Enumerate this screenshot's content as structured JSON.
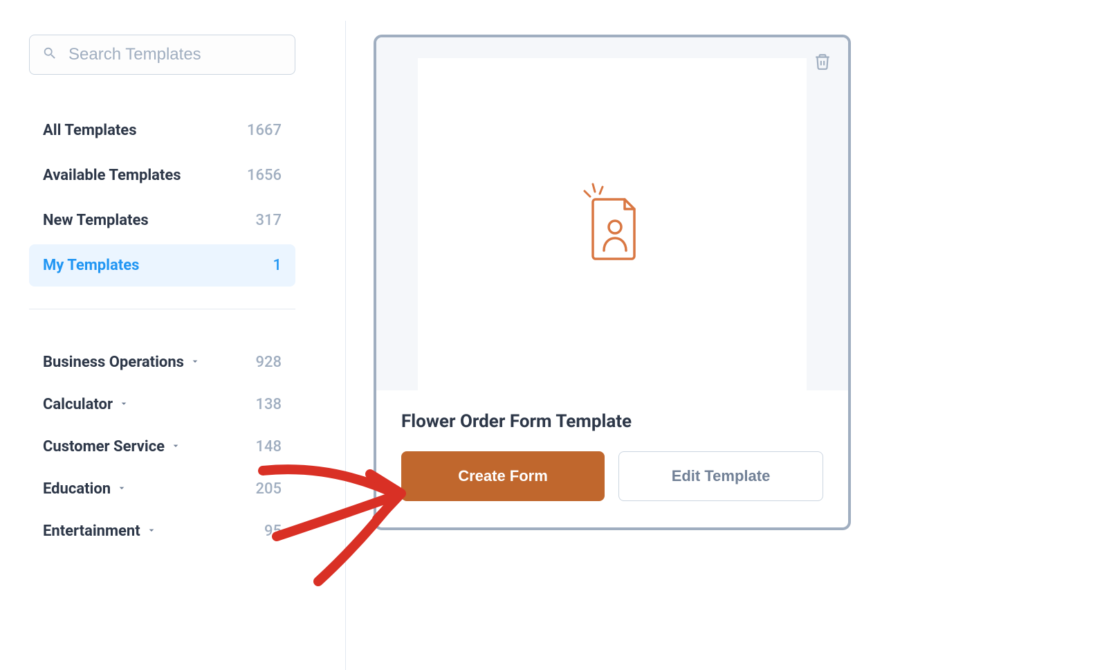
{
  "sidebar": {
    "search": {
      "placeholder": "Search Templates"
    },
    "nav": [
      {
        "label": "All Templates",
        "count": "1667",
        "active": false
      },
      {
        "label": "Available Templates",
        "count": "1656",
        "active": false
      },
      {
        "label": "New Templates",
        "count": "317",
        "active": false
      },
      {
        "label": "My Templates",
        "count": "1",
        "active": true
      }
    ],
    "categories": [
      {
        "label": "Business Operations",
        "count": "928"
      },
      {
        "label": "Calculator",
        "count": "138"
      },
      {
        "label": "Customer Service",
        "count": "148"
      },
      {
        "label": "Education",
        "count": "205"
      },
      {
        "label": "Entertainment",
        "count": "95"
      }
    ]
  },
  "card": {
    "title": "Flower Order Form Template",
    "primary_button": "Create Form",
    "secondary_button": "Edit Template"
  },
  "colors": {
    "accent_blue": "#2196f3",
    "accent_orange": "#c0672d",
    "icon_orange": "#d97742",
    "annotation_red": "#d93025"
  }
}
